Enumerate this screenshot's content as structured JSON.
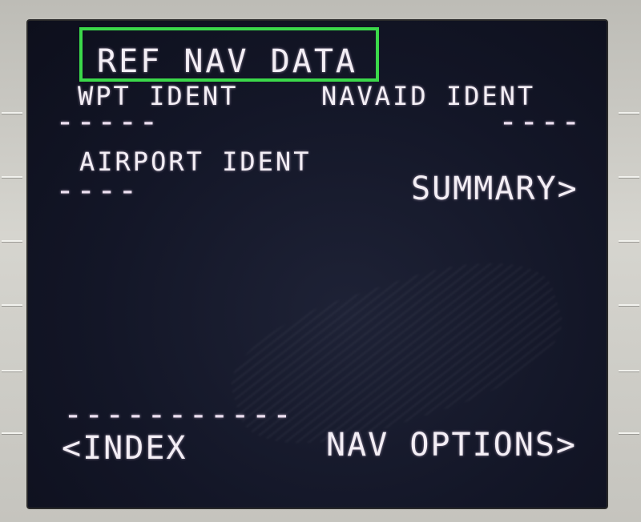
{
  "page": {
    "title": "REF NAV DATA"
  },
  "fields": {
    "wpt_ident_label": "WPT IDENT",
    "wpt_ident_value": "-----",
    "navaid_ident_label": "NAVAID IDENT",
    "navaid_ident_value": "----",
    "airport_ident_label": "AIRPORT IDENT",
    "airport_ident_value": "----"
  },
  "prompts": {
    "summary": "SUMMARY>",
    "separator": "-----------",
    "index": "<INDEX",
    "nav_options": "NAV OPTIONS>"
  },
  "colors": {
    "screen_bg": "#131627",
    "text": "#f3eef5",
    "highlight": "#3bd94a",
    "bezel": "#c9c8c3"
  }
}
